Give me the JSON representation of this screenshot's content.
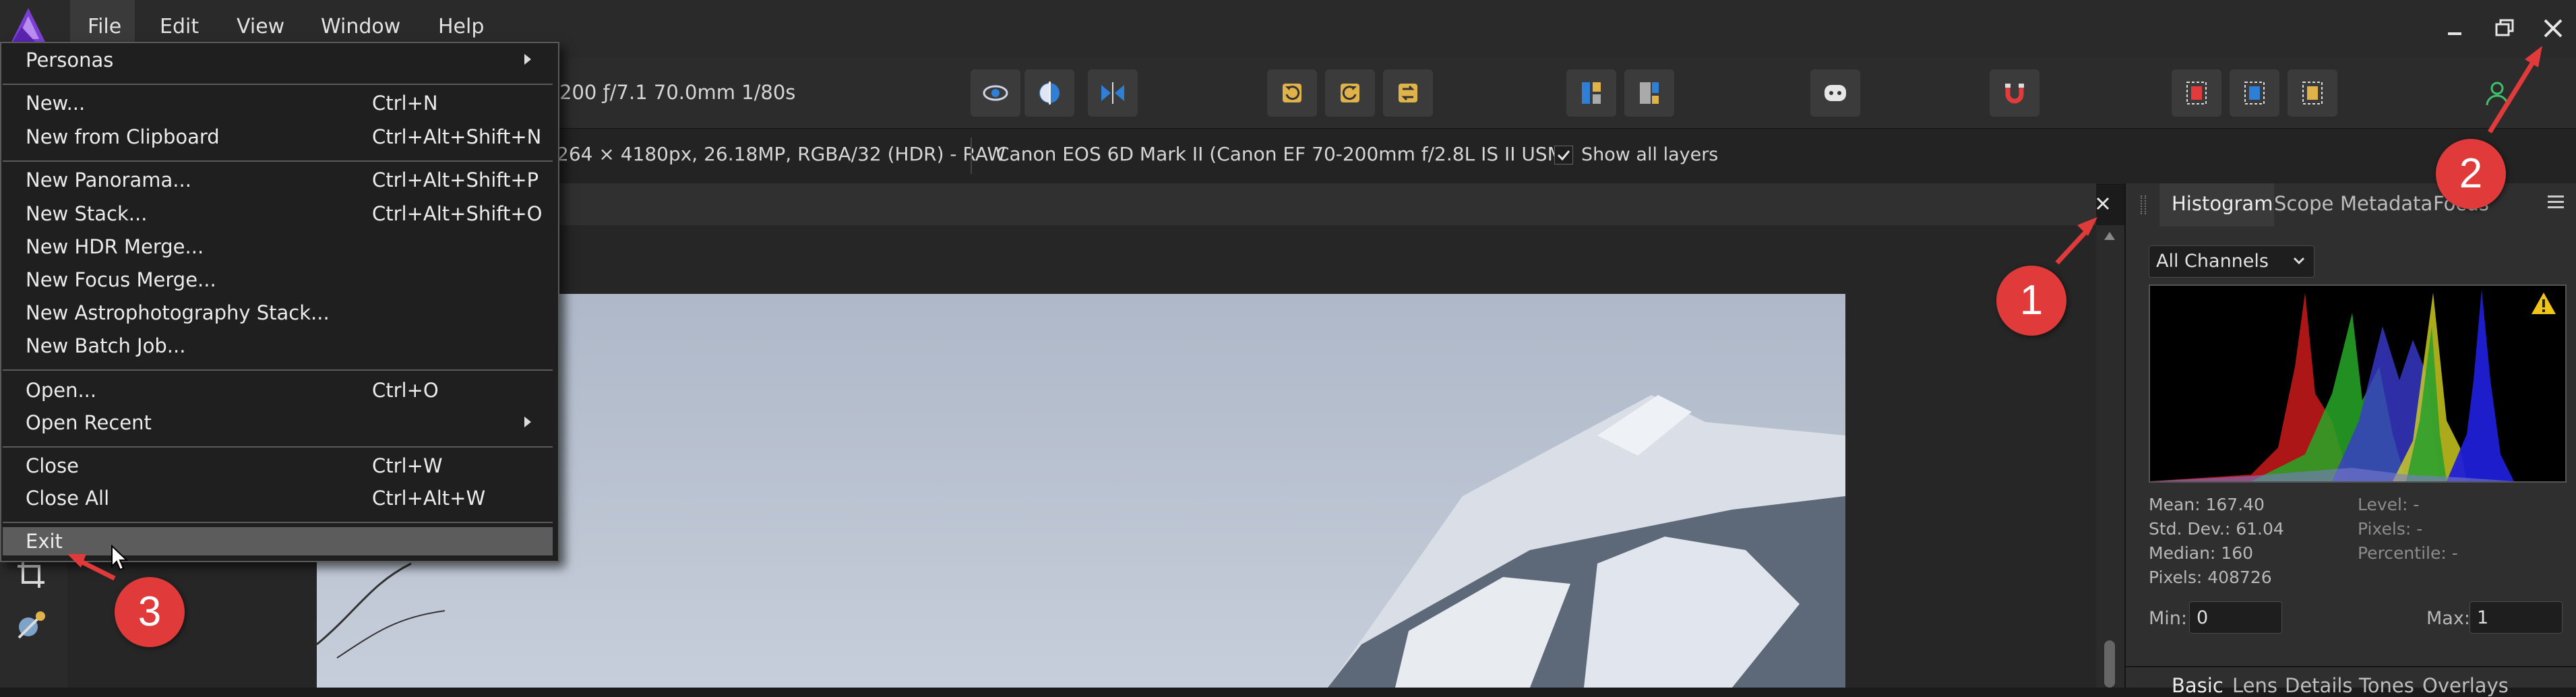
{
  "menubar": {
    "items": [
      "File",
      "Edit",
      "View",
      "Window",
      "Help"
    ]
  },
  "context_toolbar": {
    "camera_info": "200 ƒ/7.1 70.0mm 1/80s"
  },
  "info_bar": {
    "image_info": "264 × 4180px, 26.18MP, RGBA/32 (HDR) - RAW",
    "camera_model": "Canon EOS 6D Mark II (Canon EF 70-200mm f/2.8L IS II USM)",
    "show_all_layers_label": "Show all layers"
  },
  "file_menu": {
    "personas": "Personas",
    "new": "New...",
    "new_shortcut": "Ctrl+N",
    "new_from_clipboard": "New from Clipboard",
    "new_from_clipboard_shortcut": "Ctrl+Alt+Shift+N",
    "new_panorama": "New Panorama...",
    "new_panorama_shortcut": "Ctrl+Alt+Shift+P",
    "new_stack": "New Stack...",
    "new_stack_shortcut": "Ctrl+Alt+Shift+O",
    "new_hdr_merge": "New HDR Merge...",
    "new_focus_merge": "New Focus Merge...",
    "new_astrophotography_stack": "New Astrophotography Stack...",
    "new_batch_job": "New Batch Job...",
    "open": "Open...",
    "open_shortcut": "Ctrl+O",
    "open_recent": "Open Recent",
    "close": "Close",
    "close_shortcut": "Ctrl+W",
    "close_all": "Close All",
    "close_all_shortcut": "Ctrl+Alt+W",
    "exit": "Exit"
  },
  "right_panel": {
    "tabs": [
      "Histogram",
      "Scope",
      "Metadata",
      "Focus"
    ],
    "channel_select": "All Channels",
    "stats": {
      "mean": "Mean: 167.40",
      "std_dev": "Std. Dev.: 61.04",
      "median": "Median: 160",
      "pixels": "Pixels: 408726",
      "level": "Level: -",
      "pixels_sel": "Pixels: -",
      "percentile": "Percentile: -"
    },
    "min_label": "Min:",
    "min_value": "0",
    "max_label": "Max:",
    "max_value": "1",
    "bottom_tabs": [
      "Basic",
      "Lens",
      "Details",
      "Tones",
      "Overlays"
    ]
  },
  "annotations": {
    "badge_1": "1",
    "badge_2": "2",
    "badge_3": "3"
  },
  "colors": {
    "annotation_red": "#e03a3a",
    "menu_highlight": "#5c5c5c",
    "accent_blue": "#2f7fd6"
  }
}
